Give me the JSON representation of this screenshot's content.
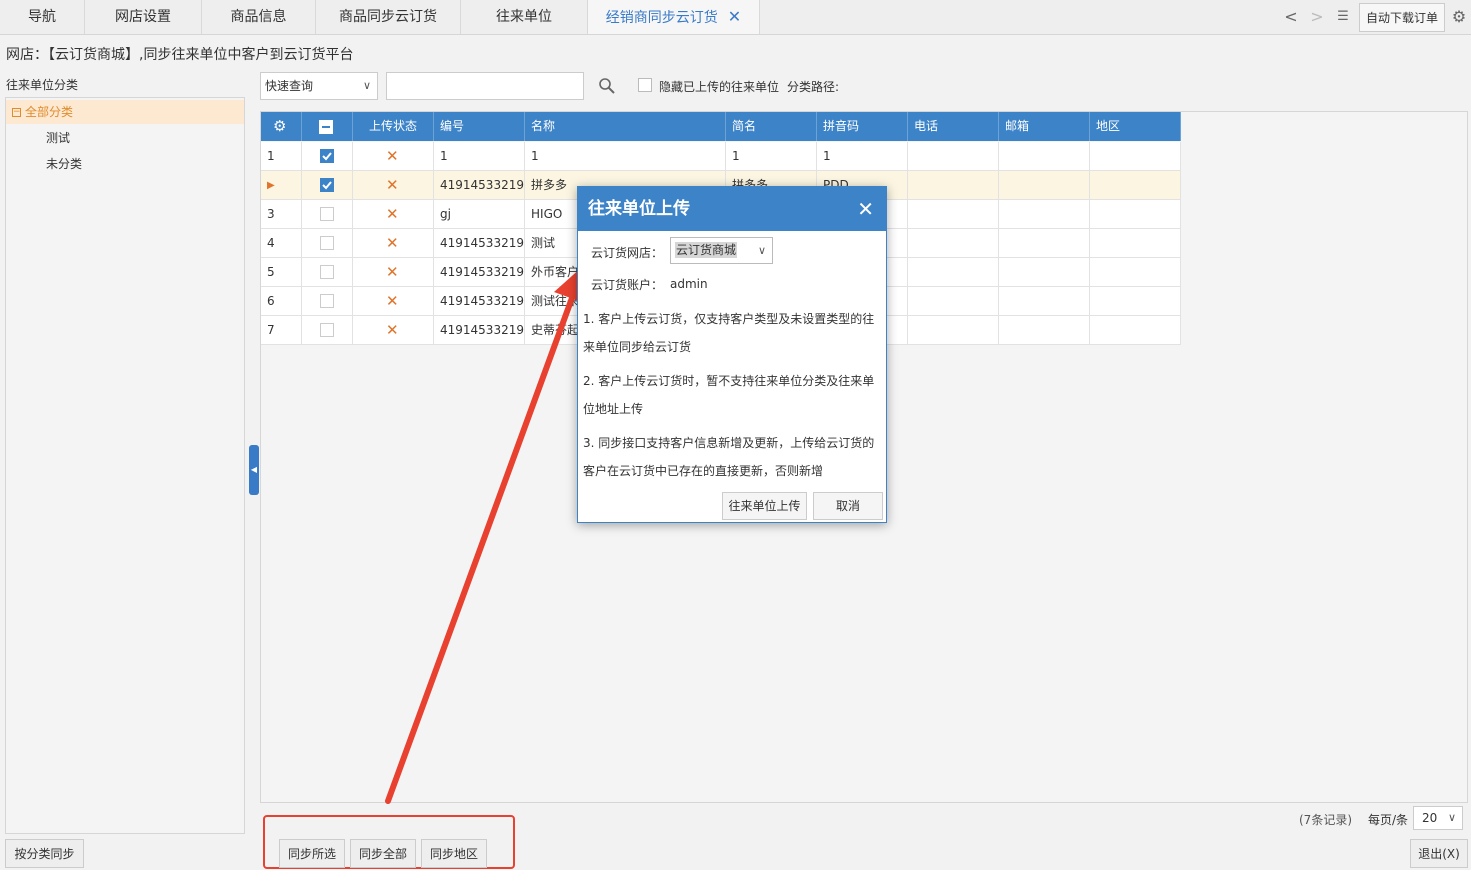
{
  "tabs": [
    {
      "label": "导航",
      "active": false
    },
    {
      "label": "网店设置",
      "active": false
    },
    {
      "label": "商品信息",
      "active": false
    },
    {
      "label": "商品同步云订货",
      "active": false
    },
    {
      "label": "往来单位",
      "active": false
    },
    {
      "label": "经销商同步云订货",
      "active": true
    }
  ],
  "toolbar_right": {
    "auto_download": "自动下载订单"
  },
  "page_title": "网店：【云订货商城】,同步往来单位中客户到云订货平台",
  "left": {
    "label": "往来单位分类",
    "tree": [
      {
        "label": "全部分类",
        "selected": true,
        "toggle": "−"
      },
      {
        "label": "测试",
        "selected": false
      },
      {
        "label": "未分类",
        "selected": false
      }
    ],
    "sync_by_category": "按分类同步"
  },
  "filter": {
    "quick_query": "快速查询",
    "search_value": "",
    "hide_uploaded": "隐藏已上传的往来单位",
    "category_path": "分类路径:"
  },
  "grid": {
    "columns": [
      "",
      "",
      "上传状态",
      "编号",
      "名称",
      "简名",
      "拼音码",
      "电话",
      "邮箱",
      "地区"
    ],
    "rows": [
      {
        "idx": "1",
        "checked": true,
        "status": "✕",
        "code": "1",
        "name": "1",
        "short": "1",
        "pinyin": "1",
        "highlight": false
      },
      {
        "idx": "▶",
        "checked": true,
        "status": "✕",
        "code": "41914533219...",
        "name": "拼多多",
        "short": "拼多多",
        "pinyin": "PDD",
        "highlight": true
      },
      {
        "idx": "3",
        "checked": false,
        "status": "✕",
        "code": "gj",
        "name": "HIGO",
        "short": "",
        "pinyin": "",
        "highlight": false
      },
      {
        "idx": "4",
        "checked": false,
        "status": "✕",
        "code": "41914533219...",
        "name": "测试",
        "short": "",
        "pinyin": "",
        "highlight": false
      },
      {
        "idx": "5",
        "checked": false,
        "status": "✕",
        "code": "41914533219...",
        "name": "外币客户",
        "short": "",
        "pinyin": "",
        "highlight": false
      },
      {
        "idx": "6",
        "checked": false,
        "status": "✕",
        "code": "41914533219...",
        "name": "测试往来",
        "short": "",
        "pinyin": "",
        "highlight": false
      },
      {
        "idx": "7",
        "checked": false,
        "status": "✕",
        "code": "41914533219...",
        "name": "史蒂芬起",
        "short": "",
        "pinyin": "",
        "highlight": false
      }
    ]
  },
  "footer": {
    "records": "(7条记录)",
    "per_page_label": "每页/条",
    "per_page_value": "20",
    "sync_selected": "同步所选",
    "sync_all": "同步全部",
    "sync_region": "同步地区",
    "exit": "退出(X)"
  },
  "dialog": {
    "title": "往来单位上传",
    "shop_label": "云订货网店：",
    "shop_value": "云订货商城",
    "account_label": "云订货账户：",
    "account_value": "admin",
    "notes": [
      "1. 客户上传云订货，仅支持客户类型及未设置类型的往来单位同步给云订货",
      "2. 客户上传云订货时，暂不支持往来单位分类及往来单位地址上传",
      "3. 同步接口支持客户信息新增及更新，上传给云订货的客户在云订货中已存在的直接更新，否则新增"
    ],
    "upload_button": "往来单位上传",
    "cancel_button": "取消"
  },
  "colors": {
    "accent": "#3d83c8",
    "annotation": "#e8412f",
    "status_x": "#e0742a"
  }
}
